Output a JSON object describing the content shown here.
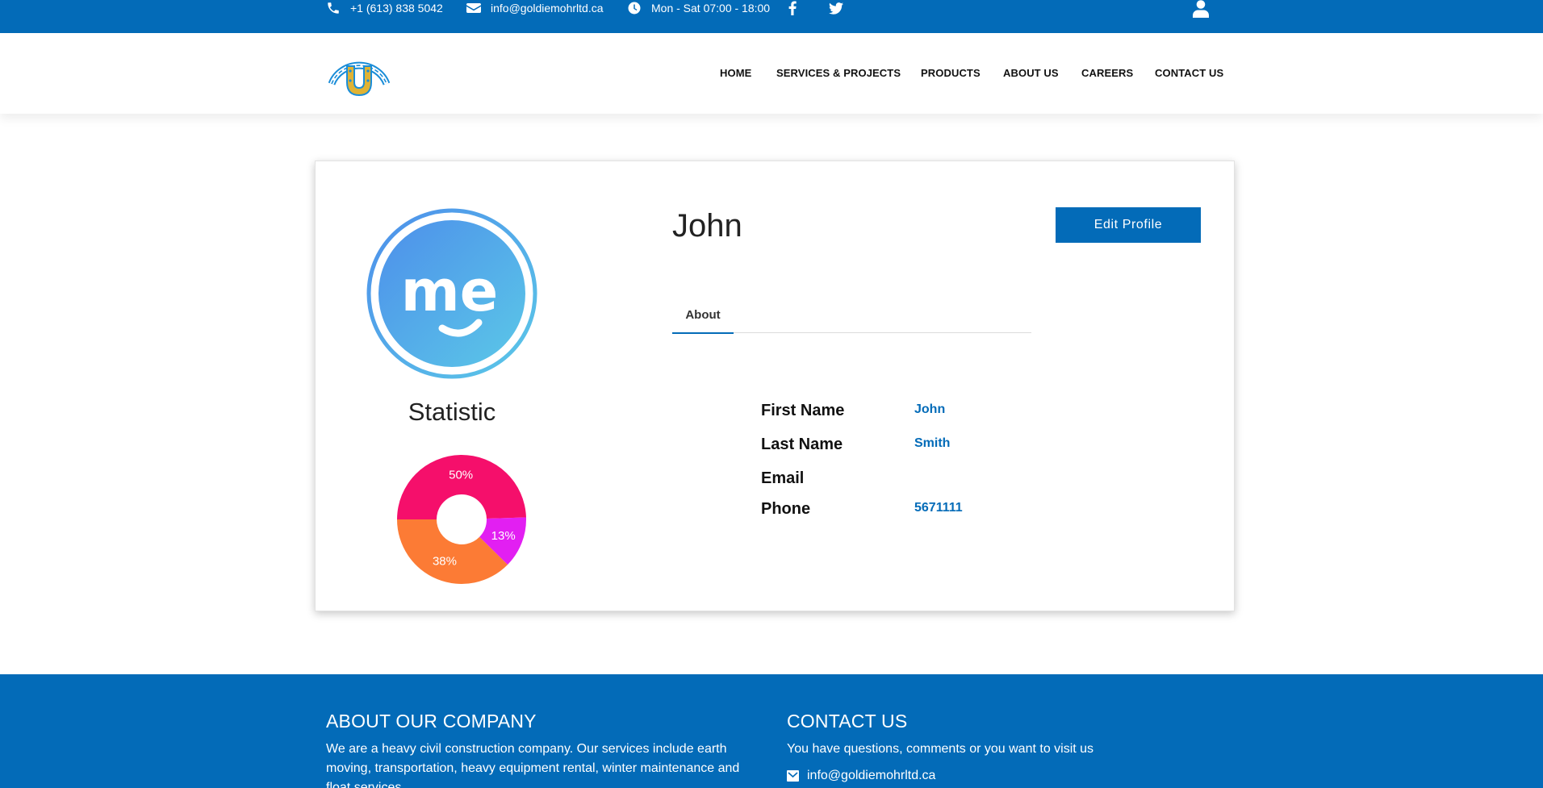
{
  "topbar": {
    "phone": "+1 (613) 838 5042",
    "email": "info@goldiemohrltd.ca",
    "hours": "Mon - Sat 07:00 - 18:00",
    "icons": [
      "phone-icon",
      "envelope-icon",
      "clock-icon",
      "facebook-icon",
      "twitter-icon",
      "user-icon"
    ]
  },
  "nav": {
    "items": [
      "HOME",
      "SERVICES & PROJECTS",
      "PRODUCTS",
      "ABOUT US",
      "CAREERS",
      "CONTACT US"
    ]
  },
  "profile": {
    "name": "John",
    "edit_label": "Edit Profile",
    "tab_label": "About",
    "statistic_title": "Statistic",
    "fields": [
      {
        "label": "First Name",
        "value": "John"
      },
      {
        "label": "Last Name",
        "value": "Smith"
      },
      {
        "label": "Email",
        "value": ""
      },
      {
        "label": "Phone",
        "value": "5671111"
      }
    ]
  },
  "chart_data": {
    "type": "pie",
    "categories": [
      "",
      "",
      ""
    ],
    "values": [
      50,
      13,
      38
    ],
    "labels": [
      "50%",
      "13%",
      "38%"
    ],
    "colors": [
      "#f50f6b",
      "#e21ff2",
      "#fc7b35"
    ],
    "hole": true
  },
  "footer": {
    "about_title": "ABOUT OUR COMPANY",
    "about_text": "We are a heavy civil construction company. Our services include earth moving, transportation, heavy equipment rental, winter maintenance and float services.",
    "contact_title": "CONTACT US",
    "contact_text": "You have questions, comments or you want to visit us",
    "contact_email": "info@goldiemohrltd.ca"
  },
  "colors": {
    "brand": "#036bb8",
    "white": "#ffffff"
  }
}
